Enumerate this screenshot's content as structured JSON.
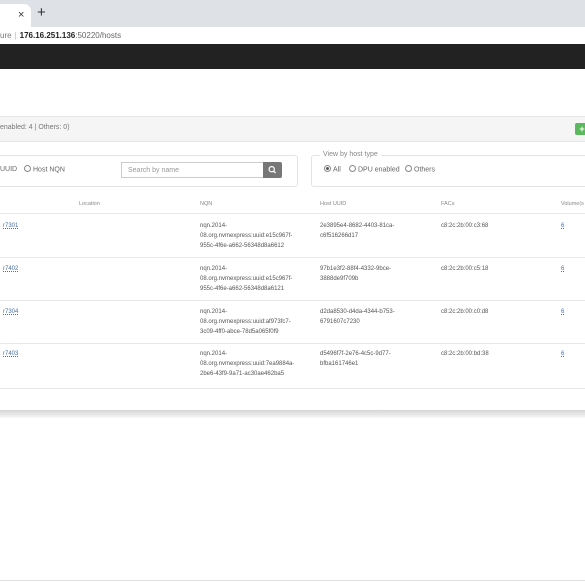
{
  "browser": {
    "tab_close": "×",
    "new_tab": "+",
    "address": {
      "security": "ure",
      "separator": "|",
      "host": "176.16.251.136",
      "path": ":50220/hosts"
    }
  },
  "summary": {
    "text": "enabled: 4 | Others: 0)",
    "add_label": "+"
  },
  "filters": {
    "id_type": {
      "options": [
        "UUID",
        "Host NQN"
      ],
      "selected": ""
    },
    "search": {
      "placeholder": "Search by name"
    },
    "host_type": {
      "legend": "View by host type",
      "options": [
        "All",
        "DPU enabled",
        "Others"
      ],
      "selected": "All"
    }
  },
  "colors": {
    "topnav": "#222222",
    "add_button": "#5cb85c",
    "search_button": "#777777"
  },
  "table": {
    "headers": {
      "location": "Location",
      "nqn": "NQN",
      "host_uuid": "Host UUID",
      "facs": "FACs",
      "volumes": "Volume(s"
    },
    "rows": [
      {
        "name": "r7301",
        "location": "",
        "nqn": [
          "nqn.2014-",
          "08.org.nvmexpress:uuid:e15c967f-",
          "955c-4f6e-a662-56348d8a6612"
        ],
        "host_uuid": [
          "2e3895e4-8682-4403-81ca-",
          "c6f516266d17"
        ],
        "facs": "c8:2c:2b:00:c3:68",
        "volumes": "6"
      },
      {
        "name": "r7402",
        "location": "",
        "nqn": [
          "nqn.2014-",
          "08.org.nvmexpress:uuid:e15c967f-",
          "955c-4f6e-a662-56348d8a6121"
        ],
        "host_uuid": [
          "97b1e3f2-88f4-4332-9bce-",
          "3888de9f709b"
        ],
        "facs": "c8:2c:2b:00:c5:18",
        "volumes": "6"
      },
      {
        "name": "r7304",
        "location": "",
        "nqn": [
          "nqn.2014-",
          "08.org.nvmexpress:uuid:af973fc7-",
          "3c09-4ff0-abce-78d5a065f0f9"
        ],
        "host_uuid": [
          "d2da8530-d4da-4344-b753-",
          "6791607c7230"
        ],
        "facs": "c8:2c:2b:00:c0:d8",
        "volumes": "6"
      },
      {
        "name": "r7403",
        "location": "",
        "nqn": [
          "nqn.2014-",
          "08.org.nvmexpress:uuid:7ea9884a-",
          "2be6-43f9-9a71-ac30ae462ba5"
        ],
        "host_uuid": [
          "d5496f7f-2e76-4c5c-9d77-",
          "bfba161746e1"
        ],
        "facs": "c8:2c:2b:00:bd:38",
        "volumes": "6"
      }
    ]
  }
}
